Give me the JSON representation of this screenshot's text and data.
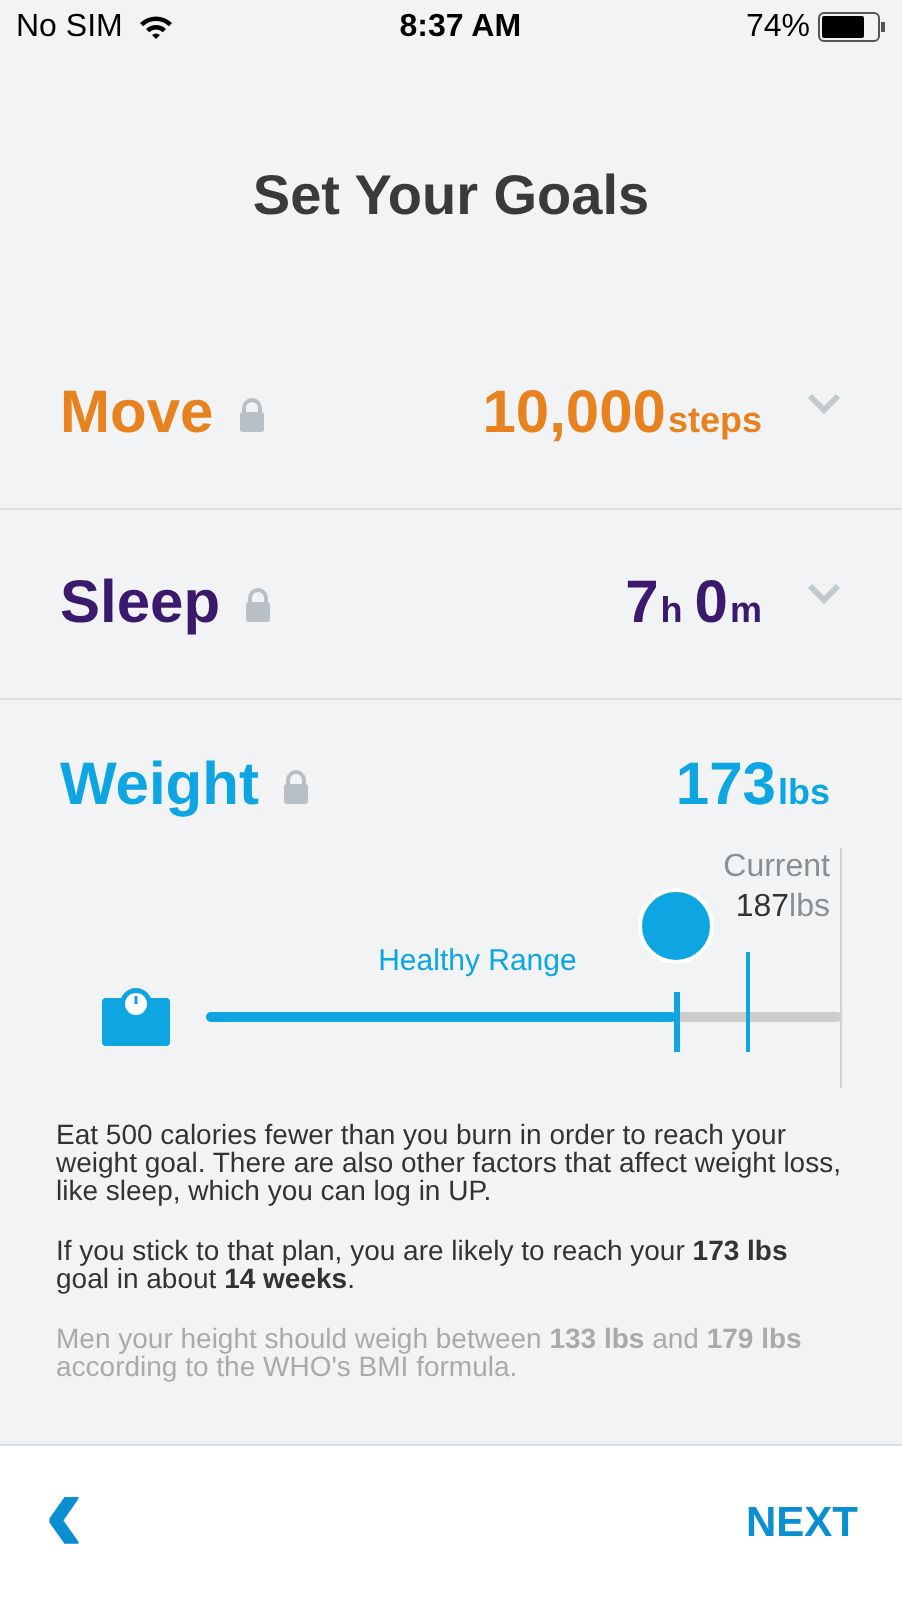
{
  "status_bar": {
    "carrier": "No SIM",
    "time": "8:37 AM",
    "battery": "74%"
  },
  "title": "Set Your Goals",
  "goals": [
    {
      "name": "Move",
      "color": "#e8821e",
      "expanded": false,
      "value": [
        {
          "num": "10,000",
          "unit": "steps"
        }
      ]
    },
    {
      "name": "Sleep",
      "color": "#3b1a6e",
      "expanded": false,
      "value": [
        {
          "num": "7",
          "unit": "h"
        },
        {
          "num": "0",
          "unit": "m"
        }
      ]
    },
    {
      "name": "Weight",
      "color": "#0ea5e3",
      "expanded": true,
      "value": [
        {
          "num": "173",
          "unit": "lbs"
        }
      ]
    }
  ],
  "weight_slider": {
    "current_label": "Current",
    "current_num": "187",
    "current_unit": "lbs",
    "range_label": "Healthy Range",
    "level": 0.74
  },
  "notes": [
    {
      "kind": "normal",
      "text": "Eat 500 calories fewer than you burn in order to reach your weight goal. There are also other factors that affect weight loss, like sleep, which you can log in UP."
    },
    {
      "kind": "normal",
      "text": "If you stick to that plan, you are likely to reach your **173 lbs** goal in about **14 weeks**."
    },
    {
      "kind": "muted",
      "text": "Men your height should weigh between **133 lbs** and **179 lbs** according to the WHO's BMI formula."
    }
  ],
  "footer": {
    "back": "‹",
    "next": "NEXT"
  }
}
